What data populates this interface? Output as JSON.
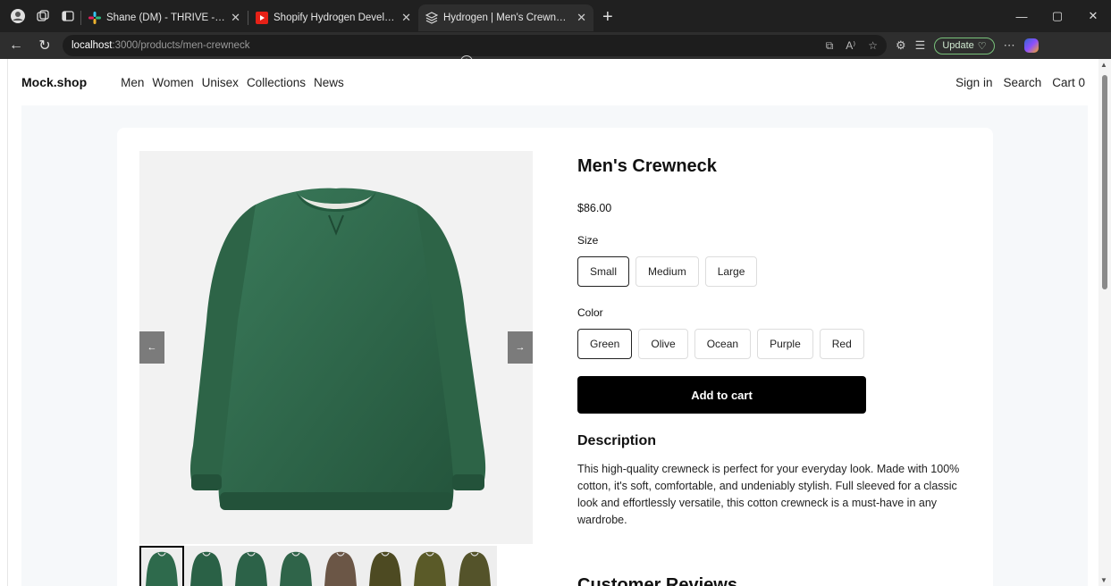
{
  "browser": {
    "tabs": [
      {
        "title": "Shane (DM) - THRIVE - Slack",
        "favicon": "slack-icon",
        "active": false
      },
      {
        "title": "Shopify Hydrogen Developer Ass",
        "favicon": "youtube-icon",
        "active": false
      },
      {
        "title": "Hydrogen | Men's Crewneck",
        "favicon": "hydrogen-icon",
        "active": true
      }
    ],
    "url_host": "localhost",
    "url_path": ":3000/products/men-crewneck",
    "update_label": "Update"
  },
  "site": {
    "logo": "Mock.shop",
    "nav": [
      "Men",
      "Women",
      "Unisex",
      "Collections",
      "News"
    ],
    "header_right": {
      "sign_in": "Sign in",
      "search": "Search",
      "cart": "Cart 0"
    }
  },
  "product": {
    "title": "Men's Crewneck",
    "price": "$86.00",
    "size_label": "Size",
    "sizes": [
      "Small",
      "Medium",
      "Large"
    ],
    "selected_size": "Small",
    "color_label": "Color",
    "colors": [
      "Green",
      "Olive",
      "Ocean",
      "Purple",
      "Red"
    ],
    "selected_color": "Green",
    "add_to_cart": "Add to cart",
    "description_heading": "Description",
    "description": "This high-quality crewneck is perfect for your everyday look. Made with 100% cotton, it's soft, comfortable, and undeniably stylish. Full sleeved for a classic look and effortlessly versatile, this cotton crewneck is a must-have in any wardrobe.",
    "reviews_heading": "Customer Reviews",
    "prev_arrow": "←",
    "next_arrow": "→",
    "thumbnails": [
      {
        "color": "#2e6a4c",
        "selected": true
      },
      {
        "color": "#2a6146",
        "selected": false
      },
      {
        "color": "#2c6248",
        "selected": false
      },
      {
        "color": "#2f6449",
        "selected": false
      },
      {
        "color": "#6b5646",
        "selected": false
      },
      {
        "color": "#4d4a22",
        "selected": false
      },
      {
        "color": "#5a5a28",
        "selected": false
      },
      {
        "color": "#54532a",
        "selected": false
      }
    ]
  },
  "colors": {
    "sweater": "#2f6a4d",
    "accent": "#000000"
  }
}
